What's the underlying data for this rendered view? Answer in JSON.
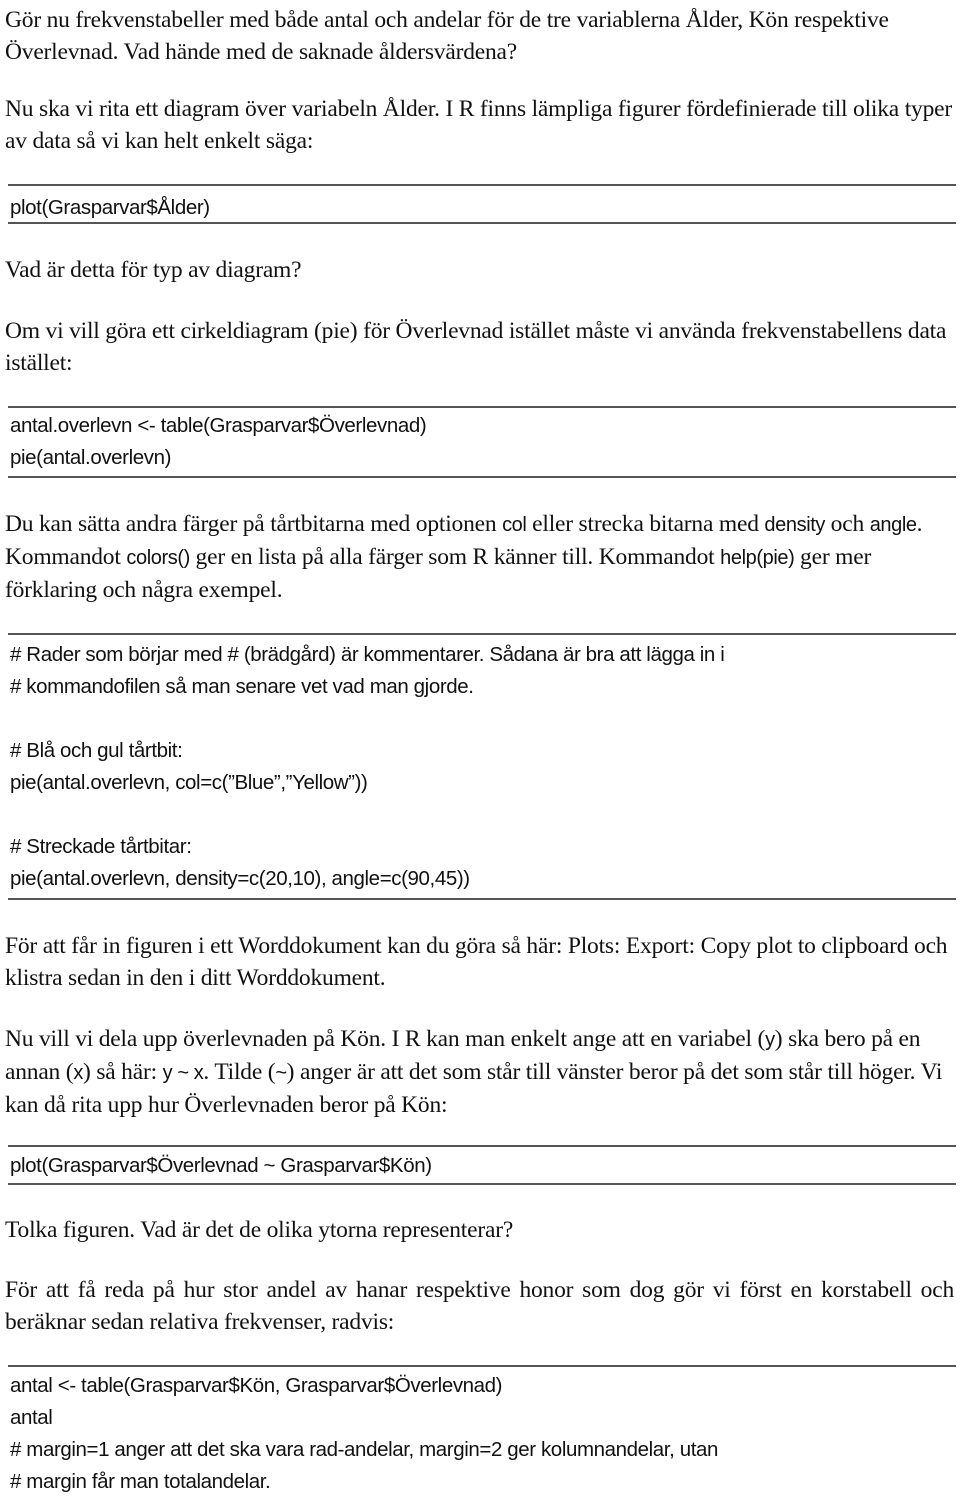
{
  "document": {
    "p1": "Gör nu frekvenstabeller med både antal och andelar för de tre variablerna Ålder, Kön respektive Överlevnad. Vad hände med de saknade åldersvärdena?",
    "p2": "Nu ska vi rita ett diagram över variabeln Ålder. I R finns lämpliga figurer fördefinierade till olika typer av data så vi kan helt enkelt säga:",
    "code1": [
      "plot(Grasparvar$Ålder)"
    ],
    "p3": "Vad är detta för typ av diagram?",
    "p4": "Om vi vill göra ett cirkeldiagram (pie) för Överlevnad istället måste vi använda frekvenstabellens data istället:",
    "code2": [
      "antal.overlevn <- table(Grasparvar$Överlevnad)",
      "pie(antal.overlevn)"
    ],
    "p5": {
      "t1": "Du kan sätta andra färger på tårtbitarna med optionen ",
      "c1": "col",
      "t2": " eller strecka bitarna med ",
      "c2": "density",
      "t3": " och ",
      "c3": "angle",
      "t4": ". Kommandot ",
      "c4": "colors()",
      "t5": " ger en lista på alla färger som R känner till. Kommandot ",
      "c5": "help(pie)",
      "t6": " ger mer förklaring och några exempel."
    },
    "code3": [
      "# Rader som börjar med # (brädgård) är kommentarer. Sådana är bra att lägga in i",
      "# kommandofilen så man senare vet vad man gjorde.",
      "",
      "# Blå och gul tårtbit:",
      "pie(antal.overlevn, col=c(”Blue”,”Yellow”))",
      "",
      "# Streckade tårtbitar:",
      "pie(antal.overlevn, density=c(20,10), angle=c(90,45))"
    ],
    "p6": "För att får in figuren i ett Worddokument kan du göra så här: Plots: Export: Copy plot to clipboard och klistra sedan in den i ditt Worddokument.",
    "p7": {
      "t1": "Nu vill vi dela upp överlevnaden på Kön. I R kan man enkelt ange att en variabel (",
      "c1": "y",
      "t2": ") ska bero på en annan (",
      "c2": "x",
      "t3": ") så här: ",
      "c3": "y ~ x",
      "t4": ". Tilde (",
      "c4": "~",
      "t5": ") anger är att det som står till vänster beror på det som står till höger. Vi kan då rita upp hur Överlevnaden beror på Kön:"
    },
    "code4": [
      "plot(Grasparvar$Överlevnad ~ Grasparvar$Kön)"
    ],
    "p8": "Tolka figuren. Vad är det de olika ytorna representerar?",
    "p9": "För att få reda på hur stor andel av hanar respektive honor som dog gör vi först en korstabell och beräknar sedan relativa frekvenser, radvis:",
    "code5": [
      "antal <- table(Grasparvar$Kön, Grasparvar$Överlevnad)",
      "antal",
      "# margin=1 anger att det ska vara rad-andelar, margin=2 ger kolumnandelar, utan",
      "# margin får man totalandelar."
    ]
  }
}
